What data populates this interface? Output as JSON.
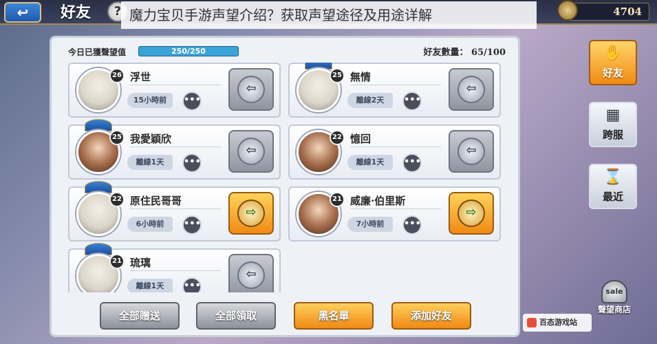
{
  "caption": "魔力宝贝手游声望介绍？获取声望途径及用途详解",
  "header": {
    "back_label": "↩",
    "title": "好友",
    "help_label": "?",
    "currency_value": "4704"
  },
  "panel": {
    "reputation_label": "今日已獲聲望值",
    "reputation_value": "250/250",
    "reputation_progress": 1.0,
    "friend_count_label": "好友數量：",
    "friend_count_value": "65/100"
  },
  "friends": [
    {
      "name": "浮世",
      "level": "26",
      "status": "15小時前",
      "gift_state": "send"
    },
    {
      "name": "無情",
      "level": "25",
      "status": "離線2天",
      "gift_state": "send"
    },
    {
      "name": "我愛穎欣",
      "level": "25",
      "status": "離線1天",
      "gift_state": "send"
    },
    {
      "name": "憶回",
      "level": "22",
      "status": "離線1天",
      "gift_state": "send"
    },
    {
      "name": "原住民哥哥",
      "level": "22",
      "status": "6小時前",
      "gift_state": "receive"
    },
    {
      "name": "威廉·伯里斯",
      "level": "21",
      "status": "7小時前",
      "gift_state": "receive"
    },
    {
      "name": "琉璃",
      "level": "21",
      "status": "離線1天",
      "gift_state": "send"
    }
  ],
  "actions": {
    "send_all": "全部贈送",
    "receive_all": "全部領取",
    "blacklist": "黑名單",
    "add_friend": "添加好友"
  },
  "side_nav": {
    "friends": "好友",
    "cross_server": "跨服",
    "recent": "最近"
  },
  "shop": {
    "label": "聲望商店",
    "icon_text": "sale"
  },
  "watermark": "百态游戏站"
}
